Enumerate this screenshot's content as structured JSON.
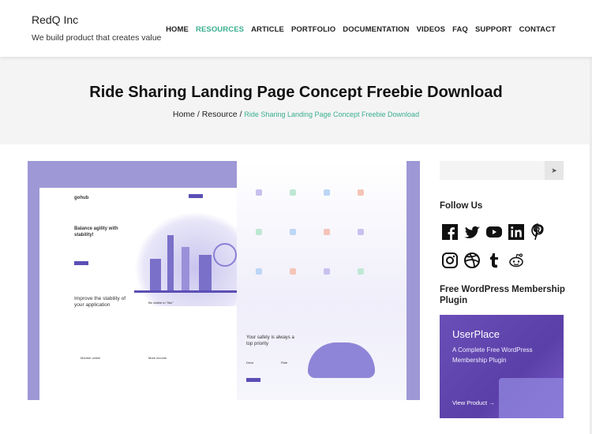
{
  "header": {
    "brand": "RedQ Inc",
    "tagline": "We build product that creates value",
    "nav": [
      {
        "label": "HOME",
        "active": false
      },
      {
        "label": "RESOURCES",
        "active": true
      },
      {
        "label": "ARTICLE",
        "active": false
      },
      {
        "label": "PORTFOLIO",
        "active": false
      },
      {
        "label": "DOCUMENTATION",
        "active": false
      },
      {
        "label": "VIDEOS",
        "active": false
      },
      {
        "label": "FAQ",
        "active": false
      },
      {
        "label": "SUPPORT",
        "active": false
      },
      {
        "label": "CONTACT",
        "active": false
      }
    ]
  },
  "hero": {
    "title": "Ride Sharing Landing Page Concept Freebie Download",
    "breadcrumb": {
      "home": "Home",
      "sep": "/",
      "resource": "Resource",
      "current": "Ride Sharing Landing Page Concept Freebie Download"
    }
  },
  "preview": {
    "logo": "gohub",
    "headline": "Balance agility with stability!",
    "section1": "Improve the stability of your application",
    "card1": "Be visible to \"like\"",
    "card2": "Monitor online",
    "card3": "More income",
    "safety": "Your safety is always a top priority",
    "drive": "Drive",
    "ride": "Ride"
  },
  "sidebar": {
    "search_icon": "send-icon",
    "follow_title": "Follow Us",
    "social": [
      "facebook",
      "twitter",
      "youtube",
      "linkedin",
      "pinterest",
      "instagram",
      "dribbble",
      "tumblr",
      "reddit"
    ],
    "plugin_title": "Free WordPress Membership Plugin",
    "banner": {
      "title": "UserPlace",
      "subtitle": "A Complete Free WordPress Membership Plugin",
      "cta": "View Product →"
    }
  },
  "colors": {
    "accent": "#3aae8f",
    "banner": "#5b3fa8",
    "preview": "#9e98d6"
  }
}
